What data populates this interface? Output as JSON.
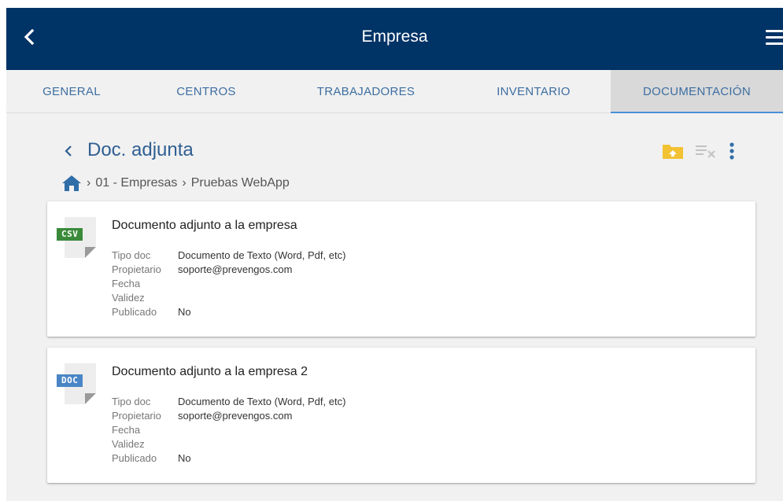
{
  "appbar": {
    "title": "Empresa"
  },
  "tabs": [
    {
      "label": "GENERAL"
    },
    {
      "label": "CENTROS"
    },
    {
      "label": "TRABAJADORES"
    },
    {
      "label": "INVENTARIO"
    },
    {
      "label": "DOCUMENTACIÓN",
      "active": true
    }
  ],
  "section": {
    "title": "Doc. adjunta"
  },
  "breadcrumb": {
    "path1": "01 - Empresas",
    "path2": "Pruebas WebApp",
    "separator": "›"
  },
  "labels": {
    "tipo": "Tipo doc",
    "propietario": "Propietario",
    "fecha": "Fecha",
    "validez": "Validez",
    "publicado": "Publicado"
  },
  "documents": [
    {
      "title": "Documento adjunto a la empresa",
      "badge": "CSV",
      "badge_color": "#3a8a3a",
      "tipo": "Documento de Texto (Word, Pdf, etc)",
      "propietario": "soporte@prevengos.com",
      "fecha": "",
      "validez": "",
      "publicado": "No"
    },
    {
      "title": "Documento adjunto a la empresa 2",
      "badge": "DOC",
      "badge_color": "#4a86c5",
      "tipo": "Documento de Texto (Word, Pdf, etc)",
      "propietario": "soporte@prevengos.com",
      "fecha": "",
      "validez": "",
      "publicado": "No"
    }
  ],
  "colors": {
    "appbar": "#003366",
    "tab_text": "#3d6ea1",
    "tab_active_underline": "#4a90d9",
    "folder_upload": "#f2c233"
  },
  "icons": {
    "back": "chevron-left-icon",
    "menu": "hamburger-menu-icon",
    "home": "home-icon",
    "upload": "folder-upload-icon",
    "clear": "clear-list-icon",
    "more": "more-vertical-icon"
  }
}
